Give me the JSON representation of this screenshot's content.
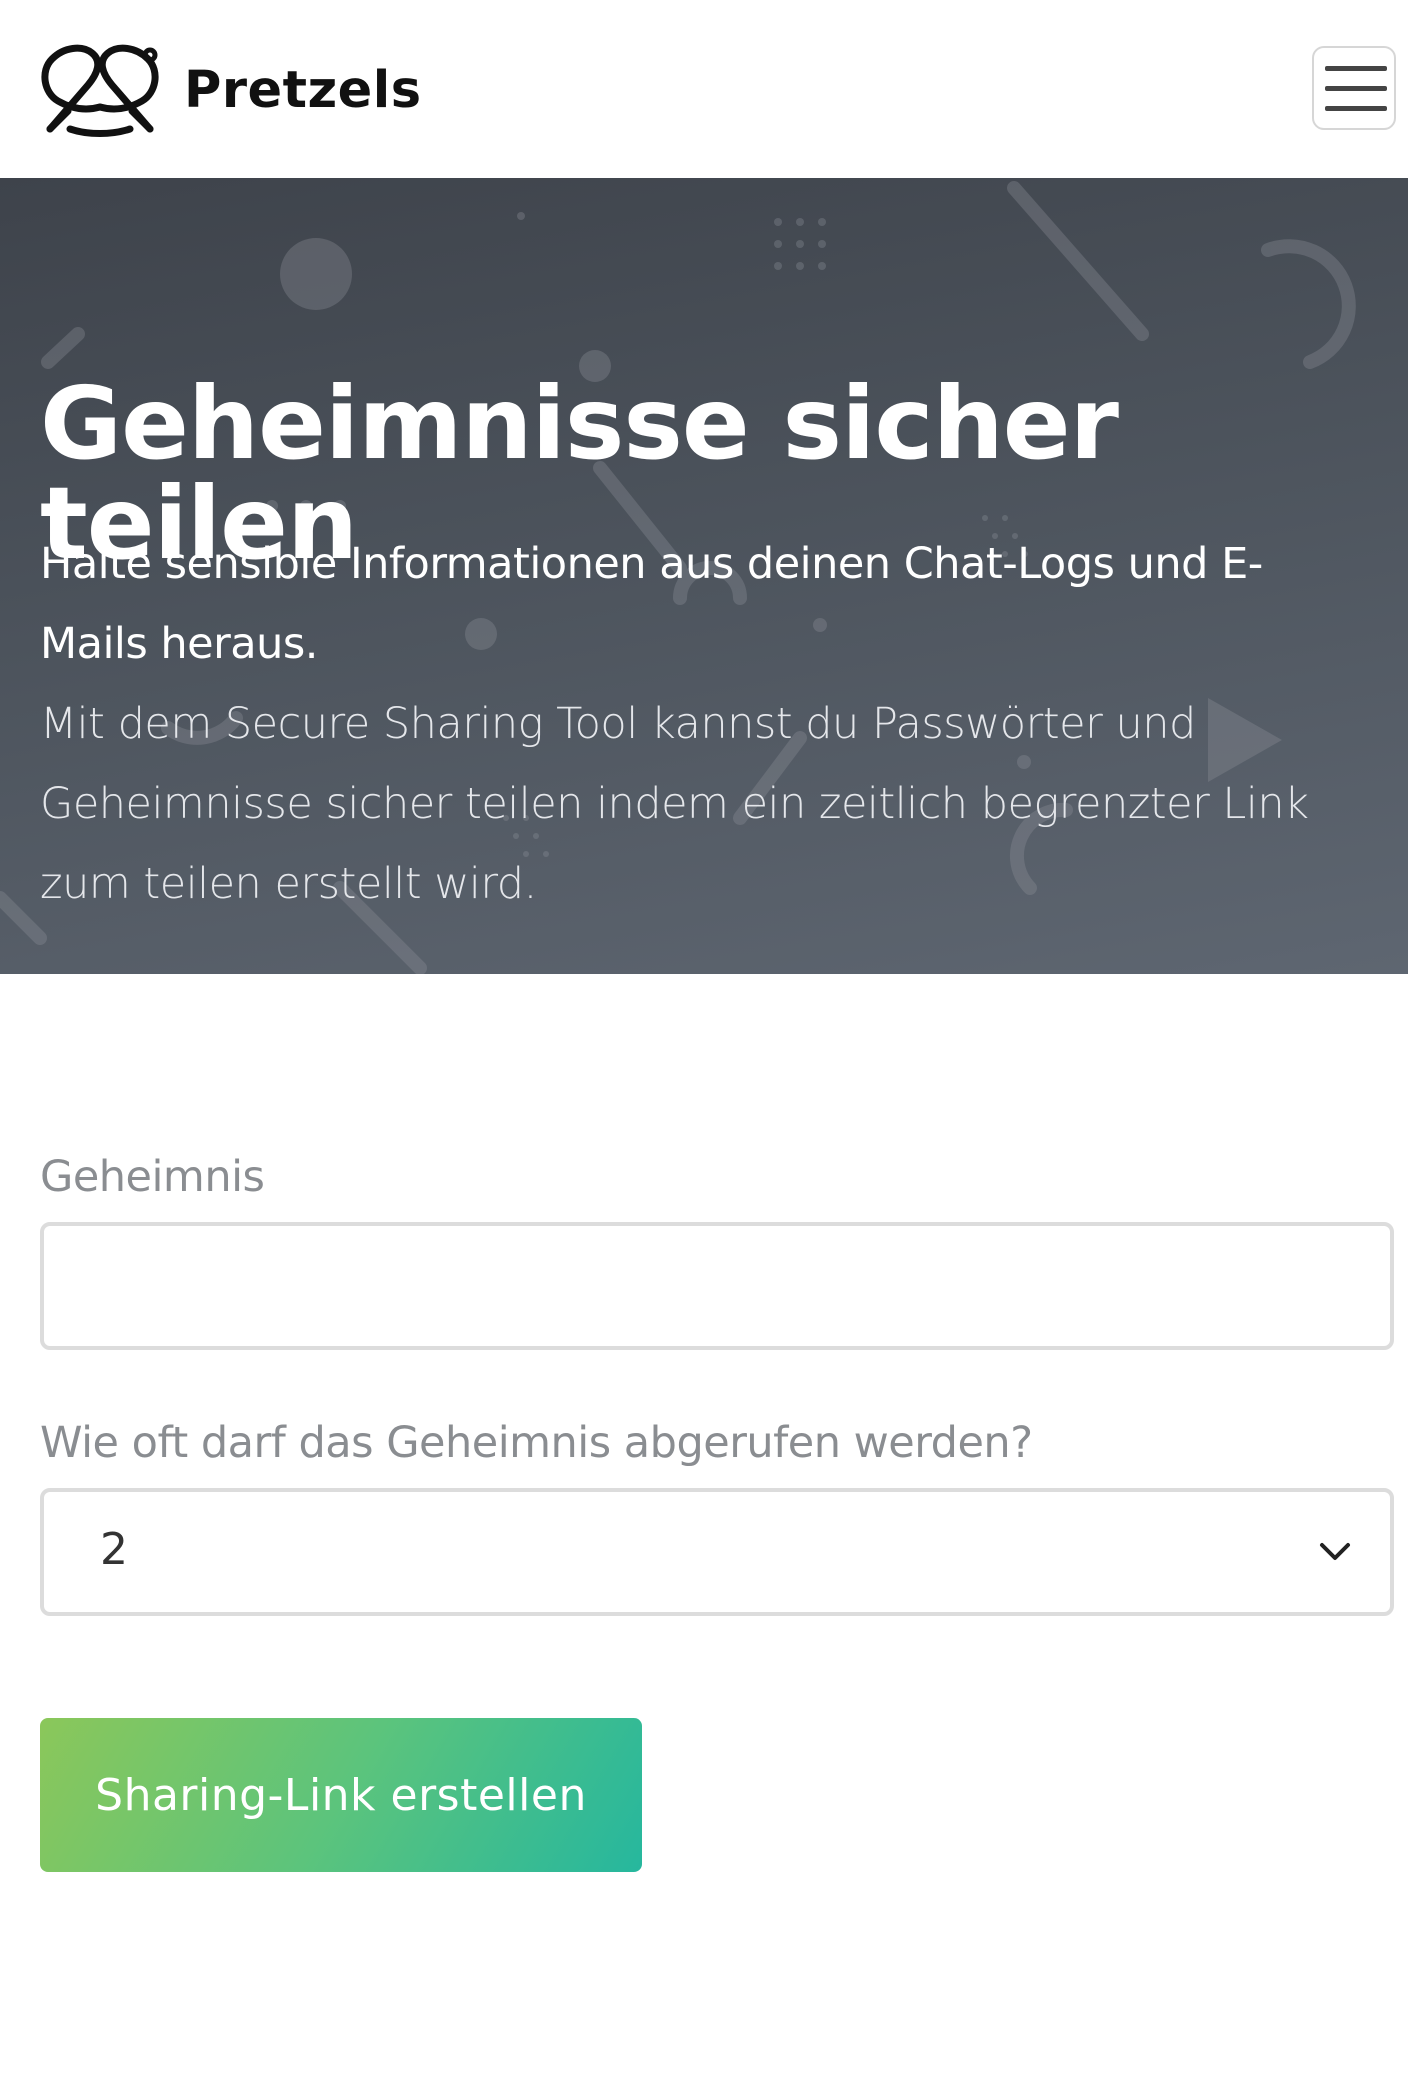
{
  "brand": {
    "name": "Pretzels",
    "logo_icon": "pretzel-logo-icon"
  },
  "header": {
    "menu_icon": "hamburger-menu-icon"
  },
  "hero": {
    "title": "Geheimnisse sicher teilen",
    "lead": "Halte sensible Informationen aus deinen Chat-Logs und E-Mails heraus.",
    "body": "Mit dem Secure Sharing Tool kannst du Passwörter und Geheimnisse sicher teilen indem ein zeitlich begrenzter Link zum teilen erstellt wird."
  },
  "form": {
    "secret_label": "Geheimnis",
    "secret_value": "",
    "count_label": "Wie oft darf das Geheimnis abgerufen werden?",
    "count_value": "2",
    "submit_label": "Sharing-Link erstellen"
  },
  "colors": {
    "hero_start": "#3e434b",
    "hero_end": "#5e6671",
    "button_start": "#8bc75a",
    "button_end": "#26b79e"
  }
}
